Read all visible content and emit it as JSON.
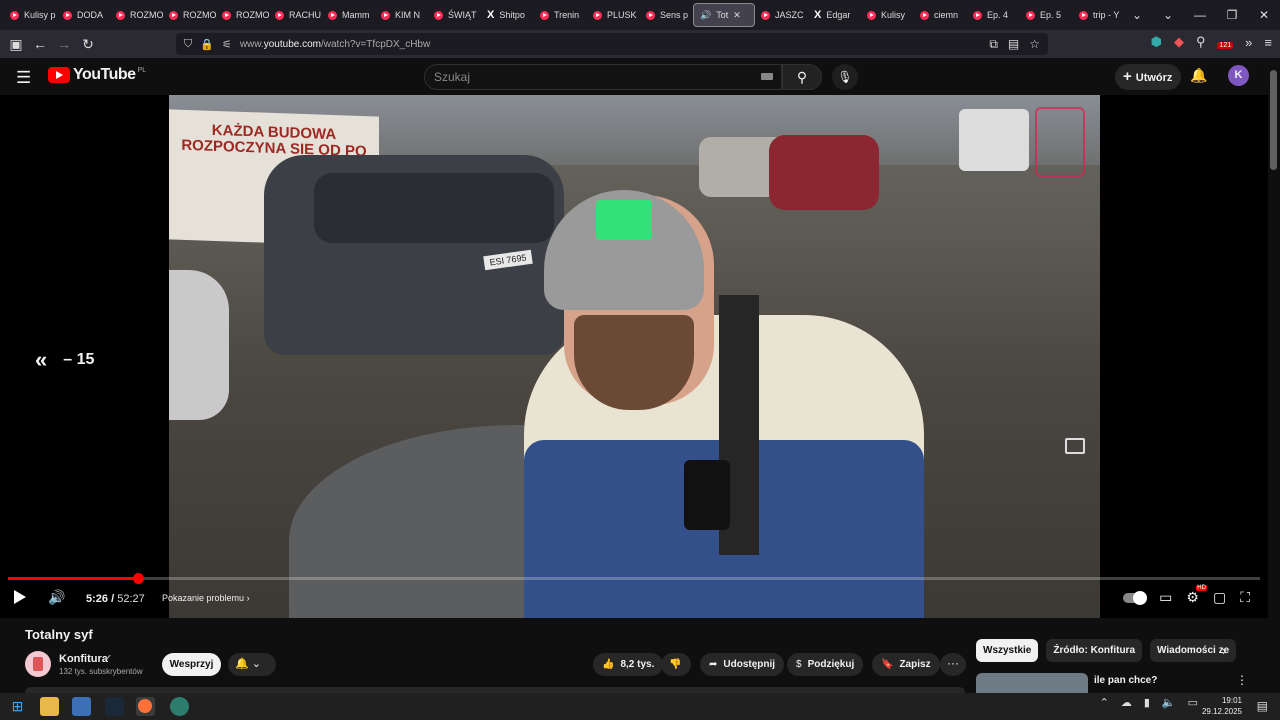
{
  "browser": {
    "tabs": [
      {
        "label": "Kulisy p",
        "icon": "youtube-icon"
      },
      {
        "label": "DODA",
        "icon": "youtube-icon"
      },
      {
        "label": "ROZMO",
        "icon": "youtube-icon"
      },
      {
        "label": "ROZMO",
        "icon": "youtube-icon"
      },
      {
        "label": "ROZMO",
        "icon": "youtube-icon"
      },
      {
        "label": "RACHU",
        "icon": "youtube-icon"
      },
      {
        "label": "Mamm",
        "icon": "youtube-icon"
      },
      {
        "label": "KIM N",
        "icon": "youtube-icon"
      },
      {
        "label": "ŚWIĄT",
        "icon": "youtube-icon"
      },
      {
        "label": "Shitpo",
        "icon": "x-icon"
      },
      {
        "label": "Trenin",
        "icon": "youtube-icon"
      },
      {
        "label": "PLUSK",
        "icon": "youtube-icon"
      },
      {
        "label": "Sens p",
        "icon": "youtube-icon"
      },
      {
        "label": "Tot",
        "icon": "speaker-icon",
        "active": true
      },
      {
        "label": "JASZC",
        "icon": "youtube-icon"
      },
      {
        "label": "Edgar",
        "icon": "x-icon"
      },
      {
        "label": "Kulisy",
        "icon": "youtube-icon"
      },
      {
        "label": "ciemn",
        "icon": "youtube-icon"
      },
      {
        "label": "Ep. 4",
        "icon": "youtube-icon"
      },
      {
        "label": "Ep. 5",
        "icon": "youtube-icon"
      },
      {
        "label": "trip - Y",
        "icon": "youtube-icon"
      }
    ],
    "url_prefix": "www.",
    "url_host": "youtube.com",
    "url_path": "/watch?v=TfcpDX_cHbw",
    "extensions_badge": "121"
  },
  "youtube": {
    "logo_text": "YouTube",
    "region": "PL",
    "search_placeholder": "Szukaj",
    "create_label": "Utwórz",
    "avatar_letter": "K"
  },
  "player": {
    "seek_back_label": "– 15",
    "current_time": "5:26",
    "duration": "52:27",
    "progress_fraction": 0.104,
    "report_label": "Pokazanie problemu",
    "video_banner_text": "KAŻDA BUDOWA ROZPOCZYNA SIE OD PO",
    "video_plate_text": "ESI 7695"
  },
  "video_info": {
    "title": "Totalny syf",
    "channel_name": "Konfitura",
    "subscribers": "132 tys. subskrybentów",
    "support_label": "Wesprzyj",
    "likes": "8,2 tys.",
    "share_label": "Udostępnij",
    "thanks_label": "Podziękuj",
    "save_label": "Zapisz"
  },
  "sidebar": {
    "chips": [
      "Wszystkie",
      "Źródło: Konfitura",
      "Wiadomości ze"
    ],
    "recommendation_title": "ile pan chce?"
  },
  "taskbar": {
    "time": "19:01",
    "date": "29.12.2025"
  },
  "colors": {
    "accent_red": "#ff0000",
    "background": "#0f0f0f",
    "avatar_purple": "#7e57c2"
  }
}
